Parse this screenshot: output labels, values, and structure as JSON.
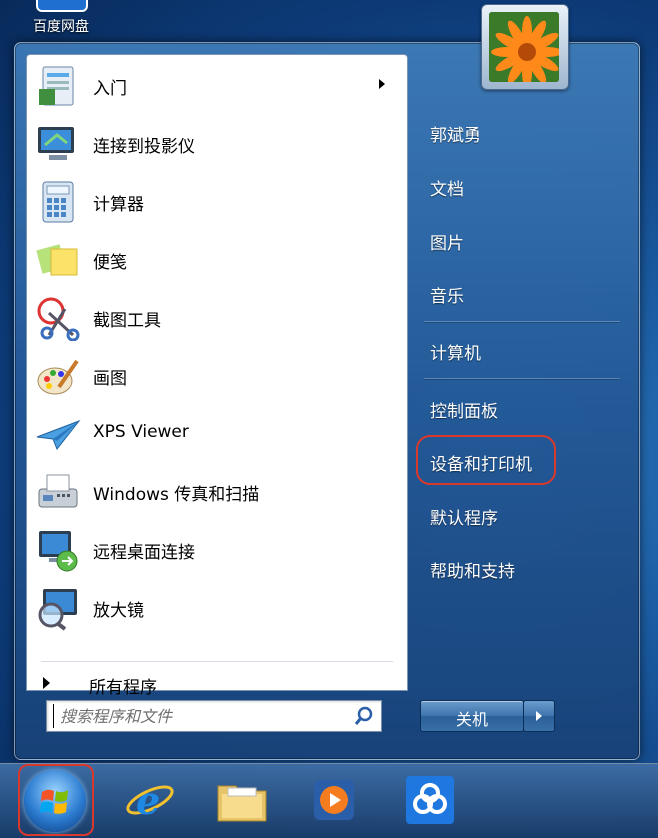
{
  "desktop": {
    "icon_label": "百度网盘"
  },
  "start_menu": {
    "programs": [
      {
        "label": "入门",
        "icon": "getting-started-icon",
        "has_submenu": true
      },
      {
        "label": "连接到投影仪",
        "icon": "projector-icon"
      },
      {
        "label": "计算器",
        "icon": "calculator-icon"
      },
      {
        "label": "便笺",
        "icon": "sticky-notes-icon"
      },
      {
        "label": "截图工具",
        "icon": "snipping-tool-icon"
      },
      {
        "label": "画图",
        "icon": "paint-icon"
      },
      {
        "label": "XPS Viewer",
        "icon": "xps-viewer-icon"
      },
      {
        "label": "Windows 传真和扫描",
        "icon": "fax-scan-icon"
      },
      {
        "label": "远程桌面连接",
        "icon": "remote-desktop-icon"
      },
      {
        "label": "放大镜",
        "icon": "magnifier-icon"
      }
    ],
    "all_programs": "所有程序",
    "search_placeholder": "搜索程序和文件",
    "right": {
      "user": "郭斌勇",
      "documents": "文档",
      "pictures": "图片",
      "music": "音乐",
      "computer": "计算机",
      "control_panel": "控制面板",
      "devices_printers": "设备和打印机",
      "default_programs": "默认程序",
      "help": "帮助和支持"
    },
    "shutdown": "关机"
  },
  "taskbar": {
    "items": [
      "start-orb",
      "internet-explorer-icon",
      "file-explorer-icon",
      "media-player-icon",
      "baidu-netdisk-icon"
    ]
  },
  "colors": {
    "highlight": "#d9392c",
    "menu_blue": "#2a5f98"
  }
}
